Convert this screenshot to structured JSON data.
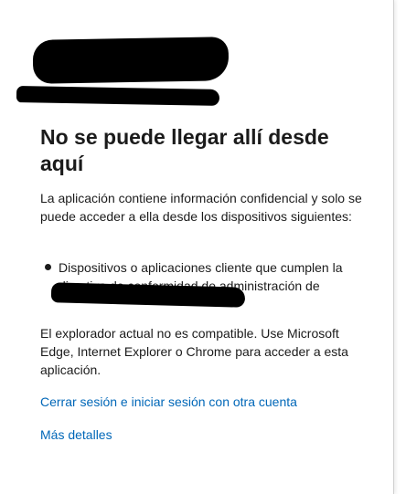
{
  "page": {
    "title": "No se puede llegar allí desde aquí",
    "description": "La aplicación contiene información confidencial y solo se puede acceder a ella desde los dispositivos siguientes:",
    "bullets": [
      "Dispositivos o aplicaciones cliente que cumplen la directiva de conformidad de administración de"
    ],
    "browser_message": "El explorador actual no es compatible. Use Microsoft Edge, Internet Explorer o Chrome para acceder a esta aplicación.",
    "links": {
      "sign_out": "Cerrar sesión e iniciar sesión con otra cuenta",
      "more_details": "Más detalles"
    }
  },
  "colors": {
    "link": "#0067b8",
    "text": "#1b1b1b",
    "background": "#ffffff"
  }
}
